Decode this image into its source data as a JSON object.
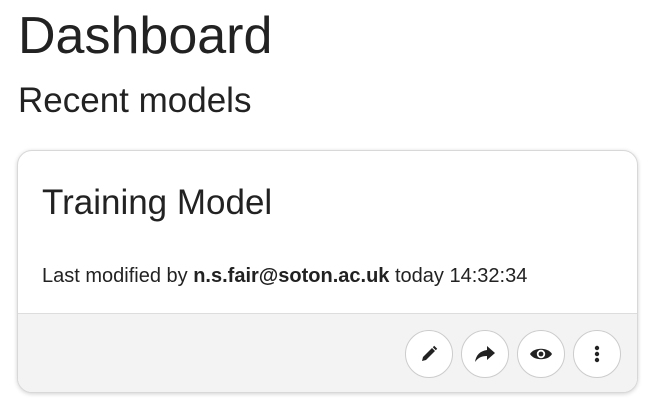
{
  "header": {
    "title": "Dashboard",
    "section_title": "Recent models"
  },
  "card": {
    "model_name": "Training Model",
    "modified_prefix": "Last modified by ",
    "modified_user": "n.s.fair@soton.ac.uk",
    "modified_suffix": " today 14:32:34",
    "actions": [
      {
        "icon": "pencil-icon",
        "name": "edit-button"
      },
      {
        "icon": "share-arrow-icon",
        "name": "share-button"
      },
      {
        "icon": "eye-icon",
        "name": "view-button"
      },
      {
        "icon": "vertical-ellipsis-icon",
        "name": "more-options-button"
      }
    ]
  },
  "colors": {
    "text": "#222222",
    "footer_bg": "#f3f3f3",
    "border": "#d8d8d8"
  }
}
